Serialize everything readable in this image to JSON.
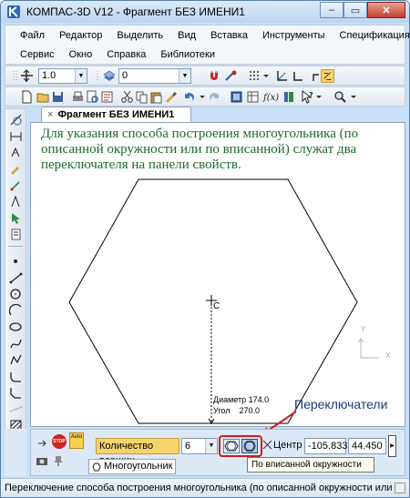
{
  "window": {
    "title": "КОМПАС-3D V12 - Фрагмент БЕЗ ИМЕНИ1",
    "minimize": "–",
    "restore": "▭",
    "close": "✕"
  },
  "menu": {
    "row1": [
      "Файл",
      "Редактор",
      "Выделить",
      "Вид",
      "Вставка",
      "Инструменты",
      "Спецификация"
    ],
    "row2": [
      "Сервис",
      "Окно",
      "Справка",
      "Библиотеки"
    ]
  },
  "toolbar1": {
    "step_value": "1.0",
    "layer_value": "0"
  },
  "document": {
    "tab_label": "Фрагмент БЕЗ ИМЕНИ1",
    "tab_close": "×",
    "note": "Для указания способа построения многоугольника (по описанной окружности или по вписанной) служат два переключателя на панели свойств.",
    "center_label": "C",
    "diameter_text": "Диаметр 174.0",
    "angle_text": "Угол    270.0",
    "axis_y": "Y",
    "axis_x": "X"
  },
  "callout": "Переключатели",
  "property_panel": {
    "vertex_count_label": "Количество вершин",
    "vertex_count_value": "6",
    "center_label": "Центр",
    "center_x": "-105.833",
    "center_y": "44.450",
    "stop_label": "STOP",
    "auto_label": "Auto",
    "tab_label": "Многоугольник",
    "tooltip": "По вписанной окружности"
  },
  "status": {
    "text": "Переключение способа построения многоугольника (по описанной окружности или по вписанной) и"
  },
  "colors": {
    "accent": "#d21b1b",
    "note_text": "#1d6b2b",
    "field_highlight": "#f6d36c",
    "window_frame": "#c9dff5"
  }
}
